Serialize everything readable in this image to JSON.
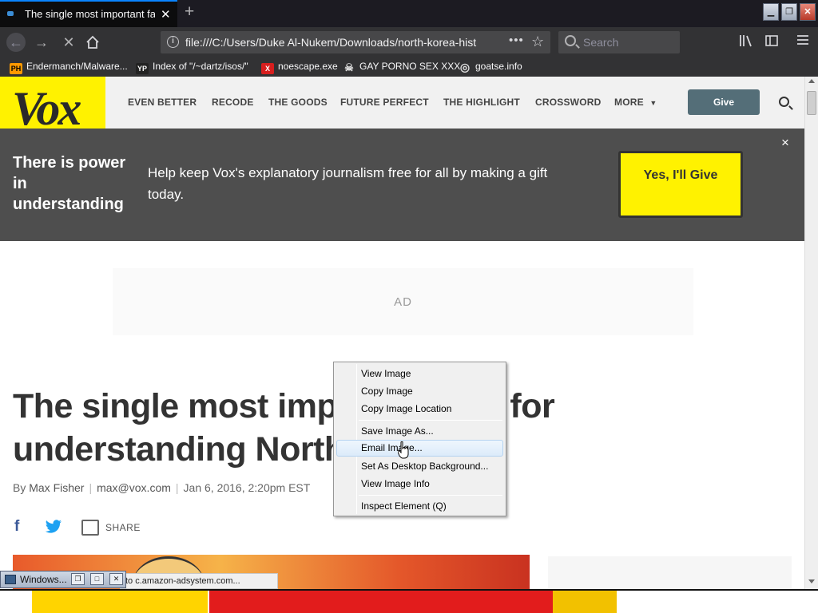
{
  "browser": {
    "tab_title": "The single most important fact",
    "url": "file:///C:/Users/Duke Al-Nukem/Downloads/north-korea-hist",
    "search_placeholder": "Search",
    "url_dots": "•••"
  },
  "bookmarks": [
    {
      "icon": "pornhub-icon",
      "icon_text": "PH",
      "label": "Endermanch/Malware..."
    },
    {
      "icon": "ycombinator-icon",
      "icon_text": "YP",
      "label": "Index of \"/~dartz/isos/\""
    },
    {
      "icon": "red-x-icon",
      "icon_text": "X",
      "label": "noescape.exe"
    },
    {
      "icon": "skull-icon",
      "icon_text": "☠",
      "label": "GAY PORNO SEX XXX"
    },
    {
      "icon": "globe-icon",
      "icon_text": "◎",
      "label": "goatse.info"
    }
  ],
  "site": {
    "logo": "Vox",
    "nav": [
      "EVEN BETTER",
      "RECODE",
      "THE GOODS",
      "FUTURE PERFECT",
      "THE HIGHLIGHT",
      "CROSSWORD",
      "MORE"
    ],
    "give_label": "Give"
  },
  "banner": {
    "heading": "There is power in understanding",
    "body": "Help keep Vox's explanatory journalism free for all by making a gift today.",
    "cta": "Yes, I'll Give",
    "close": "×"
  },
  "ad_label": "AD",
  "article": {
    "headline": "The single most important fact for understanding North Korea",
    "author_prefix": "By ",
    "author": "Max Fisher",
    "email": "max@vox.com",
    "date": "Jan 6, 2016, 2:20pm EST",
    "share_label": "SHARE",
    "facebook": "f"
  },
  "context_menu": {
    "items": [
      {
        "label": "View Image",
        "access": "I"
      },
      {
        "label": "Copy Image",
        "access": "o"
      },
      {
        "label": "Copy Image Location",
        "access": "o"
      },
      {
        "label": "Save Image As...",
        "access": "v"
      },
      {
        "label": "Email Image...",
        "access": "g",
        "hover": true
      },
      {
        "label": "Set As Desktop Background...",
        "access": "S"
      },
      {
        "label": "View Image Info",
        "access": "f"
      },
      {
        "label": "Inspect Element (Q)",
        "access": "Q"
      }
    ]
  },
  "status": {
    "text": "to c.amazon-adsystem.com...",
    "minimized_window": "Windows..."
  },
  "colors": {
    "vox_yellow": "#fff200",
    "banner_bg": "#4e4e4e",
    "give_button": "#546e78",
    "tab_accent": "#0a84ff"
  }
}
